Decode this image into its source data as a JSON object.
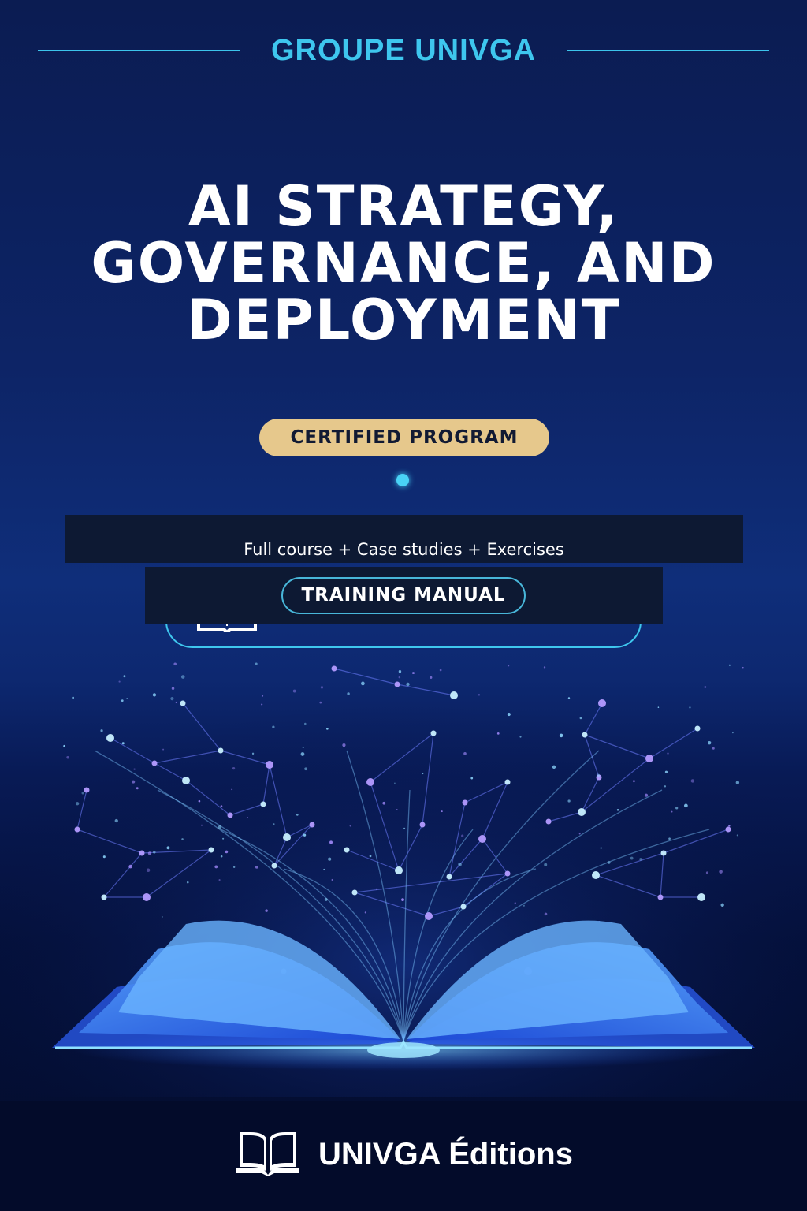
{
  "header": {
    "brand": "GROUPE UNIVGA"
  },
  "title": {
    "line1": "AI STRATEGY,",
    "line2": "GOVERNANCE, AND",
    "line3": "DEPLOYMENT"
  },
  "badge": {
    "label": "CERTIFIED PROGRAM"
  },
  "subtitle": {
    "text": "Full course + Case studies + Exercises"
  },
  "format": {
    "label": "TRAINING MANUAL"
  },
  "footer": {
    "publisher": "UNIVGA Éditions"
  },
  "colors": {
    "accent_cyan": "#3ec6ee",
    "badge_gold": "#e6c88c",
    "background_navy": "#0b1c52",
    "banner_dark": "#0d1933"
  },
  "icons": [
    "book-icon",
    "open-book-illustration"
  ]
}
